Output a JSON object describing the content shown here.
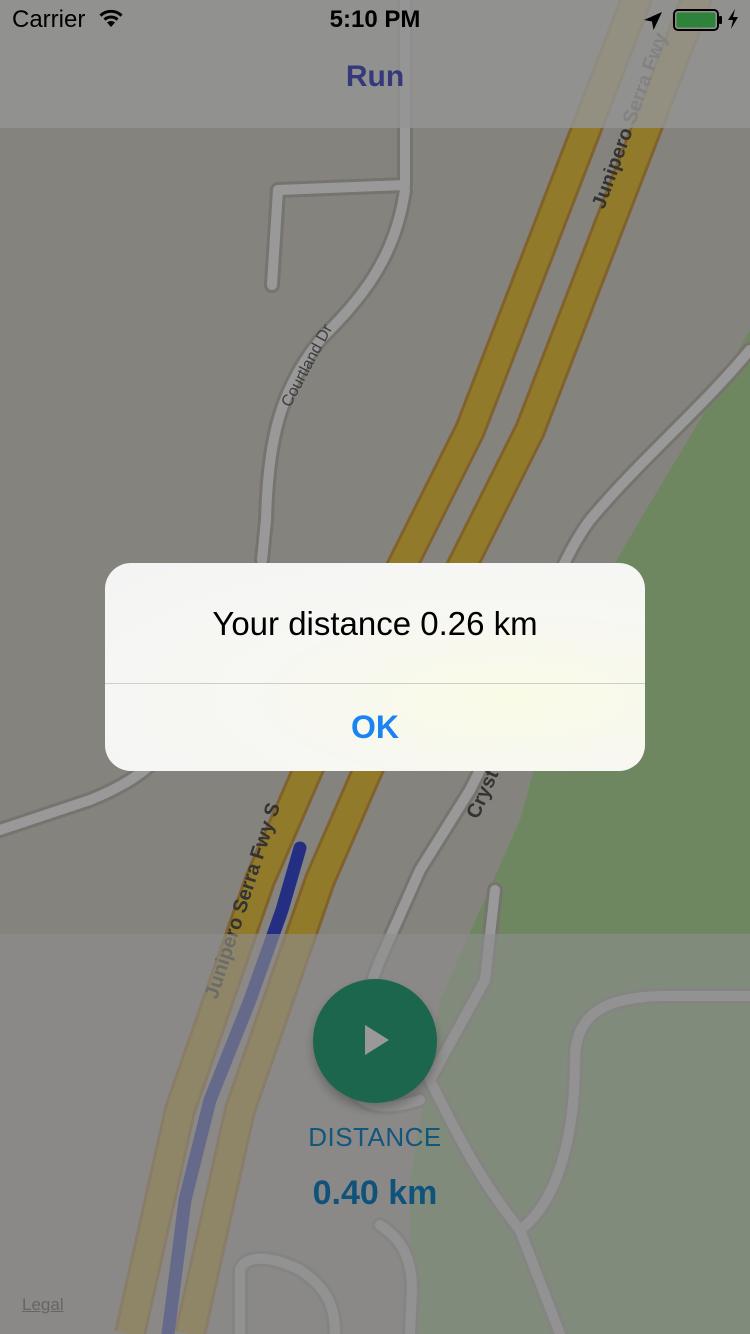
{
  "status_bar": {
    "carrier": "Carrier",
    "time": "5:10 PM",
    "icons": [
      "wifi-icon",
      "location-arrow-icon",
      "battery-icon",
      "charging-bolt-icon"
    ],
    "battery_fill": 1.0
  },
  "nav_bar": {
    "title": "Run"
  },
  "map": {
    "road_labels": [
      "Junipero Serra Fwy",
      "Junipero Serra Fwy S",
      "Courtland Dr",
      "Cryst"
    ],
    "legal_link": "Legal",
    "colors": {
      "background": "#dedad3",
      "freeway": "#f2ce48",
      "freeway_edge": "#d8a44c",
      "park": "#b7e1a1",
      "street": "#ffffff",
      "route": "#3d4fdd"
    }
  },
  "bottom_panel": {
    "play_icon": "play-icon",
    "distance_label": "DISTANCE",
    "distance_value": "0.40 km",
    "colors": {
      "button": "#2eab81",
      "text": "#1e8fcf"
    }
  },
  "alert": {
    "message": "Your distance 0.26 km",
    "ok_label": "OK",
    "colors": {
      "action": "#1a84f2"
    }
  }
}
